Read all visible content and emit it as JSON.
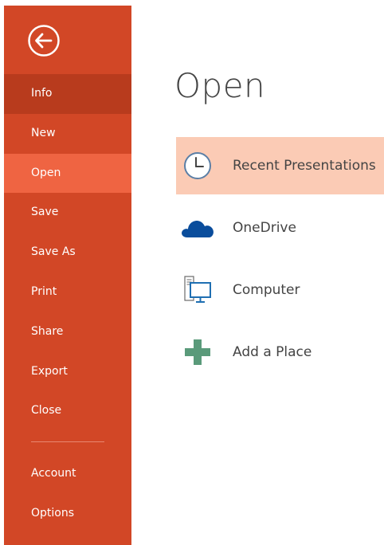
{
  "sidebar": {
    "back_icon": "back-arrow-icon",
    "items": [
      {
        "label": "Info"
      },
      {
        "label": "New"
      },
      {
        "label": "Open"
      },
      {
        "label": "Save"
      },
      {
        "label": "Save As"
      },
      {
        "label": "Print"
      },
      {
        "label": "Share"
      },
      {
        "label": "Export"
      },
      {
        "label": "Close"
      }
    ],
    "bottom_items": [
      {
        "label": "Account"
      },
      {
        "label": "Options"
      }
    ],
    "selected": "Open"
  },
  "main": {
    "title": "Open",
    "places": [
      {
        "label": "Recent Presentations",
        "icon": "clock-icon"
      },
      {
        "label": "OneDrive",
        "icon": "cloud-icon"
      },
      {
        "label": "Computer",
        "icon": "computer-icon"
      },
      {
        "label": "Add a Place",
        "icon": "plus-icon"
      }
    ]
  },
  "colors": {
    "sidebar": "#d24726",
    "sidebar_info": "#b83b1d",
    "sidebar_selected": "#ef6442",
    "recent_highlight": "#fbcbb5"
  }
}
